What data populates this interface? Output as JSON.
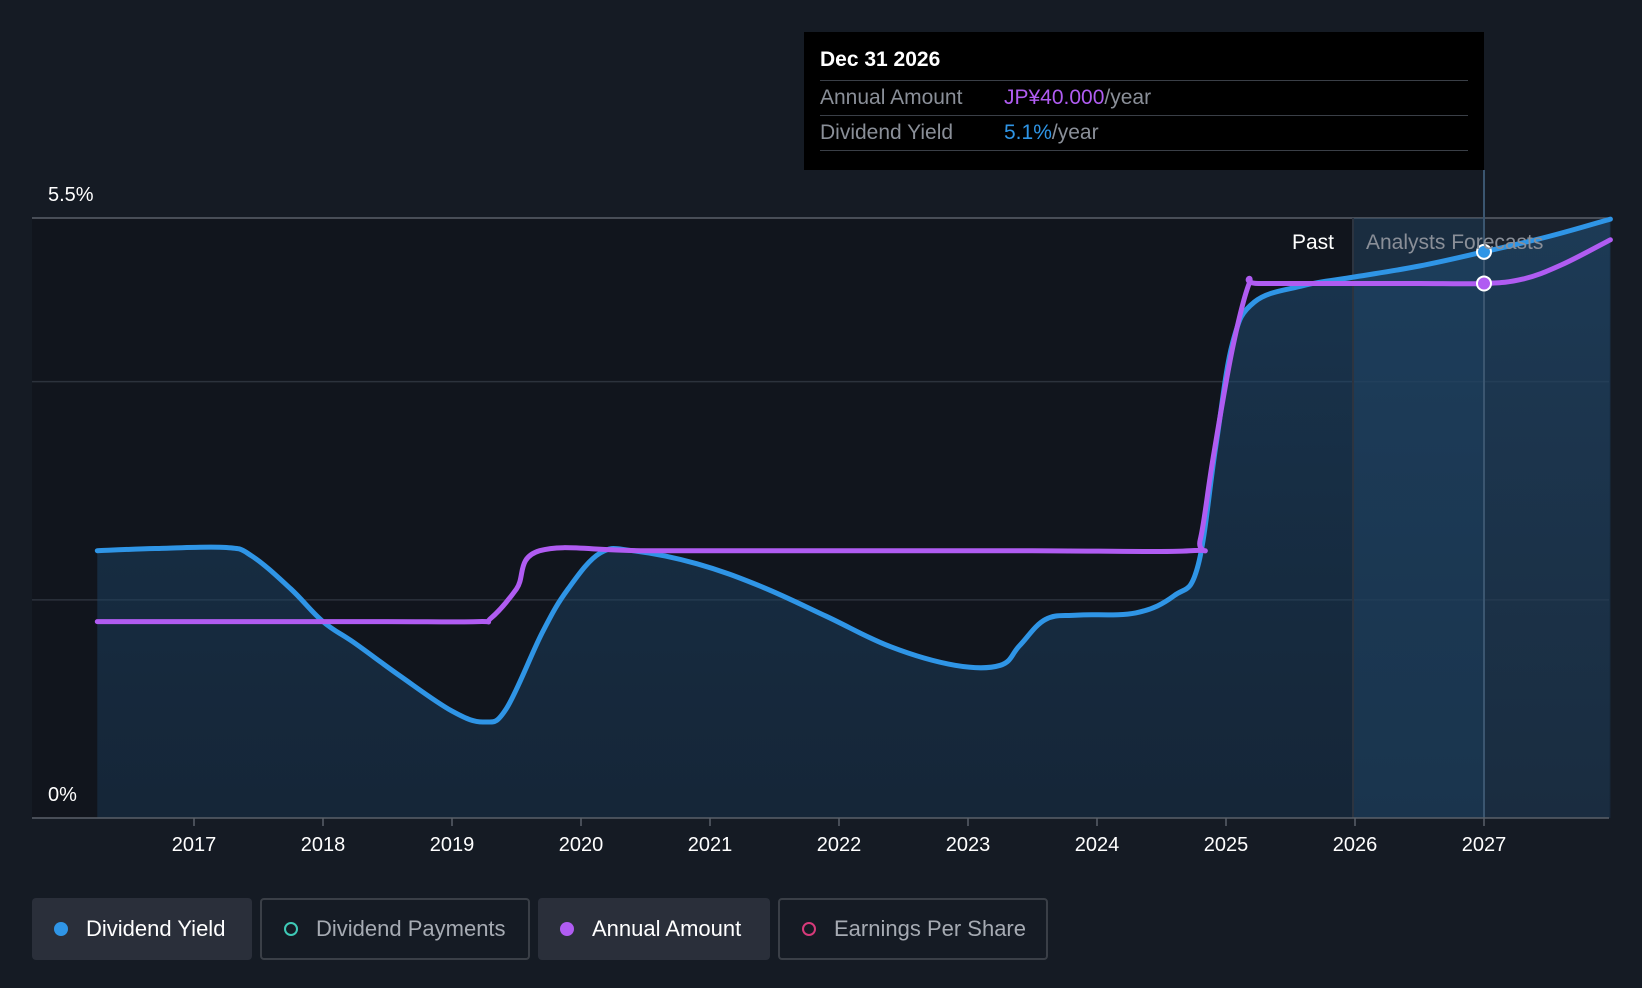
{
  "chart_data": {
    "type": "line",
    "x_ticks": [
      "2017",
      "2018",
      "2019",
      "2020",
      "2021",
      "2022",
      "2023",
      "2024",
      "2025",
      "2026",
      "2027"
    ],
    "y_labels": [
      "5.5%",
      "0%"
    ],
    "ylim": [
      0,
      5.5
    ],
    "regions": {
      "past": "Past",
      "forecast": "Analysts Forecasts"
    },
    "series": [
      {
        "name": "Dividend Yield",
        "color": "#2f95e6",
        "points": [
          [
            2016.25,
            2.45
          ],
          [
            2016.7,
            2.47
          ],
          [
            2017.25,
            2.48
          ],
          [
            2017.45,
            2.4
          ],
          [
            2017.75,
            2.1
          ],
          [
            2018.0,
            1.8
          ],
          [
            2018.25,
            1.6
          ],
          [
            2018.6,
            1.3
          ],
          [
            2019.0,
            0.98
          ],
          [
            2019.25,
            0.88
          ],
          [
            2019.42,
            1.0
          ],
          [
            2019.7,
            1.7
          ],
          [
            2019.9,
            2.1
          ],
          [
            2020.15,
            2.43
          ],
          [
            2020.4,
            2.45
          ],
          [
            2020.9,
            2.33
          ],
          [
            2021.4,
            2.12
          ],
          [
            2021.9,
            1.85
          ],
          [
            2022.4,
            1.57
          ],
          [
            2022.9,
            1.4
          ],
          [
            2023.25,
            1.4
          ],
          [
            2023.4,
            1.58
          ],
          [
            2023.6,
            1.82
          ],
          [
            2023.85,
            1.86
          ],
          [
            2024.3,
            1.88
          ],
          [
            2024.6,
            2.04
          ],
          [
            2024.78,
            2.3
          ],
          [
            2024.92,
            3.4
          ],
          [
            2025.05,
            4.35
          ],
          [
            2025.22,
            4.73
          ],
          [
            2025.6,
            4.88
          ],
          [
            2026.0,
            4.96
          ],
          [
            2026.5,
            5.06
          ],
          [
            2027.0,
            5.19
          ],
          [
            2027.5,
            5.33
          ],
          [
            2027.98,
            5.49
          ]
        ]
      },
      {
        "name": "Annual Amount",
        "color": "#b05cf2",
        "points": [
          [
            2016.25,
            1.8
          ],
          [
            2017.5,
            1.8
          ],
          [
            2018.5,
            1.8
          ],
          [
            2019.2,
            1.8
          ],
          [
            2019.3,
            1.83
          ],
          [
            2019.5,
            2.1
          ],
          [
            2019.68,
            2.45
          ],
          [
            2020.5,
            2.45
          ],
          [
            2022.0,
            2.45
          ],
          [
            2023.5,
            2.45
          ],
          [
            2024.72,
            2.45
          ],
          [
            2024.8,
            2.55
          ],
          [
            2024.9,
            3.3
          ],
          [
            2025.05,
            4.3
          ],
          [
            2025.18,
            4.9
          ],
          [
            2025.25,
            4.9
          ],
          [
            2026.0,
            4.9
          ],
          [
            2026.5,
            4.9
          ],
          [
            2027.0,
            4.9
          ],
          [
            2027.3,
            4.94
          ],
          [
            2027.6,
            5.07
          ],
          [
            2027.98,
            5.3
          ]
        ]
      }
    ],
    "hover": {
      "x": 2027.0
    }
  },
  "tooltip": {
    "date": "Dec 31 2026",
    "rows": [
      {
        "label": "Annual Amount",
        "value": "JP¥40.000",
        "unit": "/year"
      },
      {
        "label": "Dividend Yield",
        "value": "5.1%",
        "unit": "/year"
      }
    ]
  },
  "legend": [
    {
      "label": "Dividend Yield",
      "color": "#2f95e6",
      "active": true
    },
    {
      "label": "Dividend Payments",
      "color": "#3ec9b6",
      "active": false
    },
    {
      "label": "Annual Amount",
      "color": "#b05cf2",
      "active": true
    },
    {
      "label": "Earnings Per Share",
      "color": "#d63a7a",
      "active": false
    }
  ]
}
